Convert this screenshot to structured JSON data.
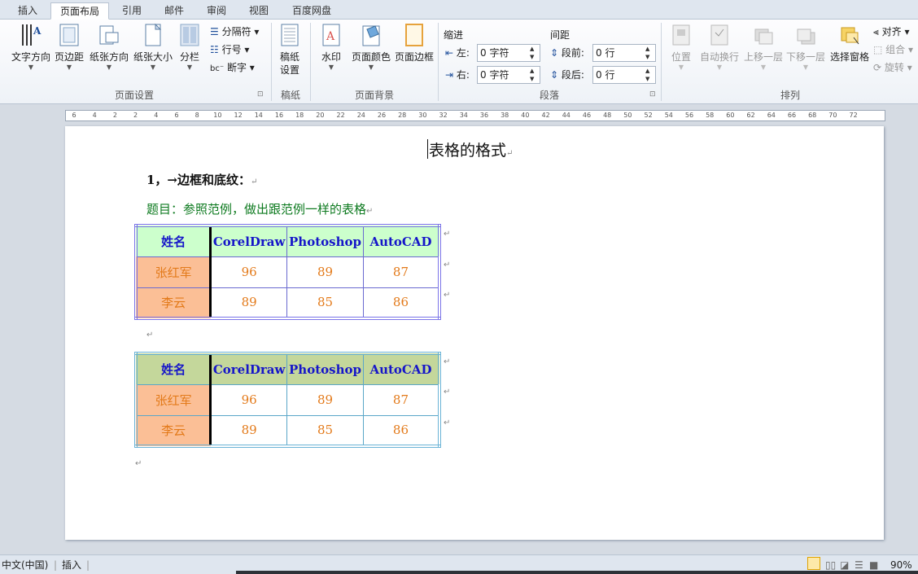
{
  "tabs": [
    "插入",
    "页面布局",
    "引用",
    "邮件",
    "审阅",
    "视图",
    "百度网盘"
  ],
  "ribbon": {
    "page_setup": {
      "buttons": [
        "文字方向",
        "页边距",
        "纸张方向",
        "纸张大小",
        "分栏"
      ],
      "small": [
        "分隔符",
        "行号",
        "断字"
      ],
      "label": "页面设置"
    },
    "draft": {
      "button": "稿纸\n设置",
      "btn_line1": "稿纸",
      "btn_line2": "设置",
      "label": "稿纸"
    },
    "page_background": {
      "buttons": [
        "水印",
        "页面颜色",
        "页面边框"
      ],
      "label": "页面背景"
    },
    "paragraph": {
      "indent_title": "缩进",
      "spacing_title": "间距",
      "indent_left_label": "左:",
      "indent_left_value": "0 字符",
      "indent_right_label": "右:",
      "indent_right_value": "0 字符",
      "before_label": "段前:",
      "before_value": "0 行",
      "after_label": "段后:",
      "after_value": "0 行",
      "label": "段落"
    },
    "arrange": {
      "buttons": [
        "位置",
        "自动换行",
        "上移一层",
        "下移一层",
        "选择窗格"
      ],
      "small": [
        "对齐",
        "组合",
        "旋转"
      ],
      "label": "排列"
    }
  },
  "ruler": [
    "6",
    "4",
    "2",
    "2",
    "4",
    "6",
    "8",
    "10",
    "12",
    "14",
    "16",
    "18",
    "20",
    "22",
    "24",
    "26",
    "28",
    "30",
    "32",
    "34",
    "36",
    "38",
    "40",
    "42",
    "44",
    "46",
    "48",
    "50",
    "52",
    "54",
    "56",
    "58",
    "60",
    "62",
    "64",
    "66",
    "68",
    "70",
    "72"
  ],
  "document": {
    "title": "表格的格式",
    "section": "1，→边框和底纹：",
    "task": "题目：参照范例，做出跟范例一样的表格"
  },
  "table1": {
    "headers": [
      "姓名",
      "CorelDraw",
      "Photoshop",
      "AutoCAD"
    ],
    "rows": [
      {
        "name": "张红军",
        "values": [
          "96",
          "89",
          "87"
        ]
      },
      {
        "name": "李云",
        "values": [
          "89",
          "85",
          "86"
        ]
      }
    ],
    "header_bg": "#ccffcc",
    "name_bg": "#fbbf96"
  },
  "table2": {
    "headers": [
      "姓名",
      "CorelDraw",
      "Photoshop",
      "AutoCAD"
    ],
    "rows": [
      {
        "name": "张红军",
        "values": [
          "96",
          "89",
          "87"
        ]
      },
      {
        "name": "李云",
        "values": [
          "89",
          "85",
          "86"
        ]
      }
    ],
    "header_bg": "#c4d79b",
    "name_bg": "#fbbf96"
  },
  "statusbar": {
    "language": "中文(中国)",
    "mode": "插入",
    "zoom": "90%"
  },
  "para_mark": "↵"
}
